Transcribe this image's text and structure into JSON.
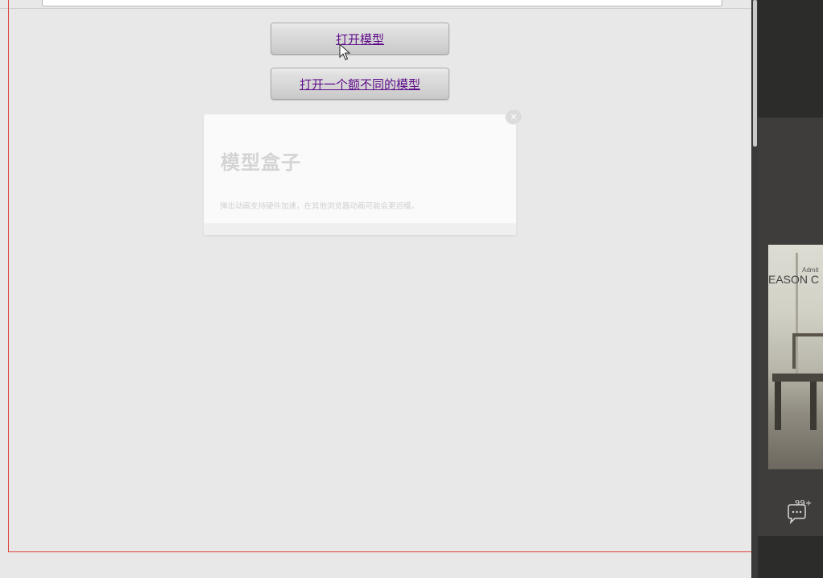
{
  "buttons": {
    "open_modal": "打开模型",
    "open_other_modal": "打开一个额不同的模型"
  },
  "modal": {
    "title": "模型盒子",
    "description": "弹出动画支持硬件加速，在其他浏览器动画可能会更迟缓。",
    "close_icon": "close-x"
  },
  "side": {
    "album_title": "EASON C",
    "album_small_text": "Admit",
    "chat_badge": "99+"
  },
  "colors": {
    "link": "#5f0d8a",
    "frame_outline": "#e0433c",
    "background": "#e8e8e8"
  }
}
